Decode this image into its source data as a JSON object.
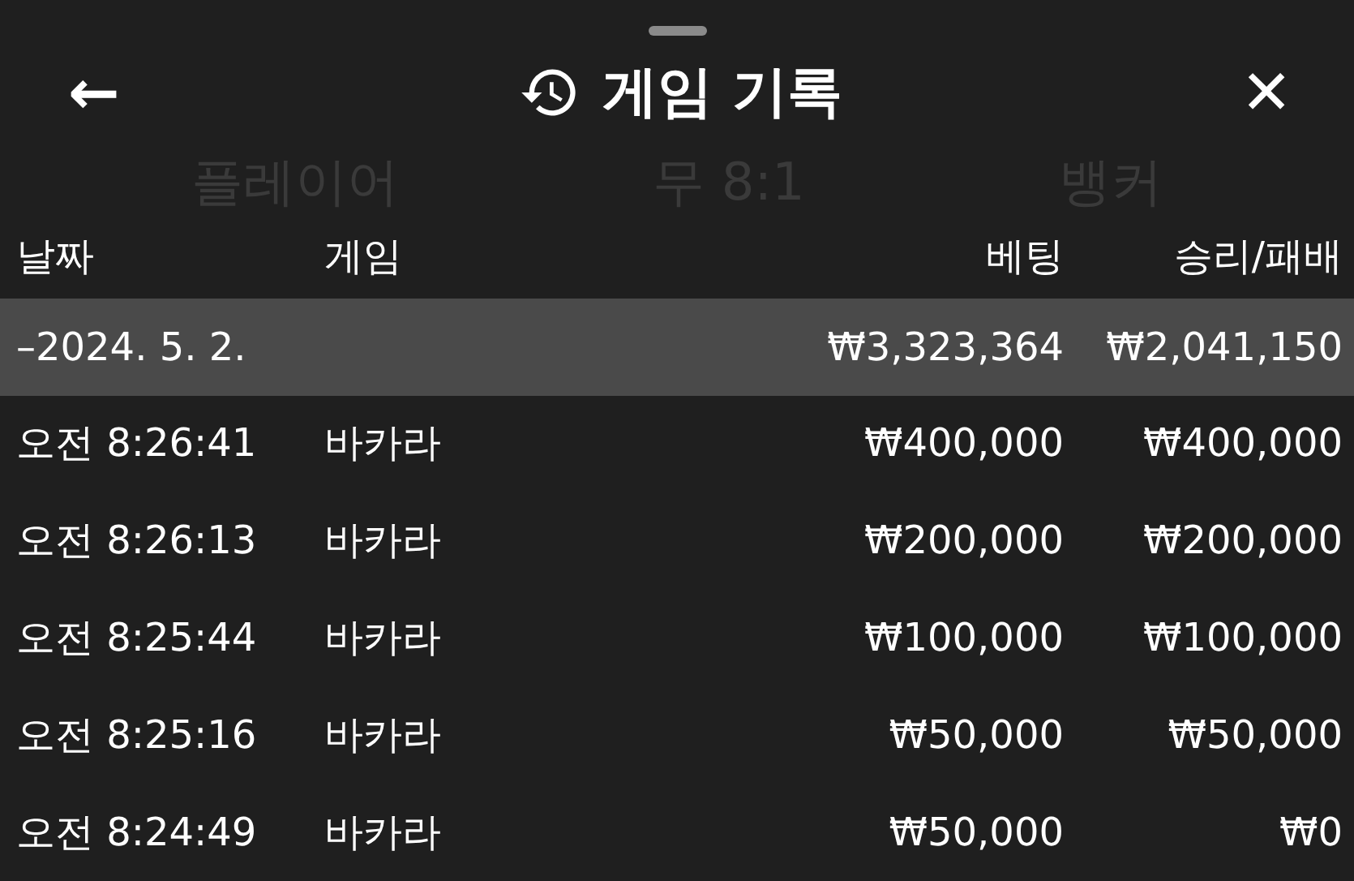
{
  "header": {
    "back": "←",
    "title": "게임 기록",
    "close": "✕"
  },
  "background_labels": [
    "플레이어",
    "무 8:1",
    "뱅커"
  ],
  "columns": [
    "날짜",
    "게임",
    "베팅",
    "승리/패배"
  ],
  "summary": {
    "date": "–2024. 5. 2.",
    "bet": "₩3,323,364",
    "result": "₩2,041,150"
  },
  "rows": [
    {
      "time": "오전 8:26:41",
      "game": "바카라",
      "bet": "₩400,000",
      "result": "₩400,000"
    },
    {
      "time": "오전 8:26:13",
      "game": "바카라",
      "bet": "₩200,000",
      "result": "₩200,000"
    },
    {
      "time": "오전 8:25:44",
      "game": "바카라",
      "bet": "₩100,000",
      "result": "₩100,000"
    },
    {
      "time": "오전 8:25:16",
      "game": "바카라",
      "bet": "₩50,000",
      "result": "₩50,000"
    },
    {
      "time": "오전 8:24:49",
      "game": "바카라",
      "bet": "₩50,000",
      "result": "₩0"
    }
  ]
}
